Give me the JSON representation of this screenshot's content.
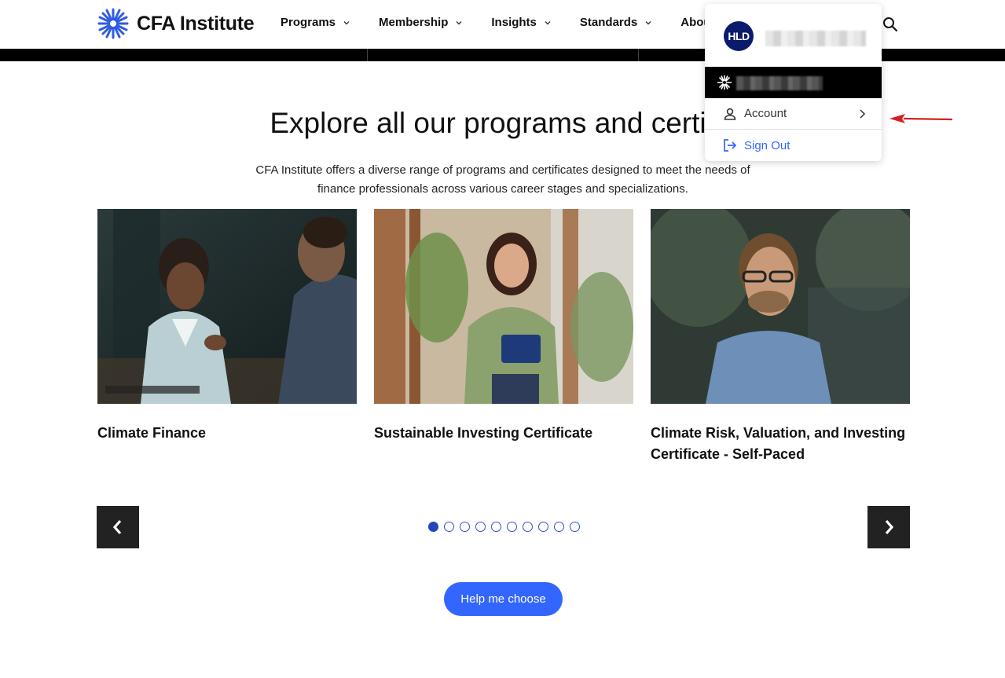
{
  "header": {
    "logo_text": "CFA Institute",
    "nav": [
      {
        "label": "Programs"
      },
      {
        "label": "Membership"
      },
      {
        "label": "Insights"
      },
      {
        "label": "Standards"
      },
      {
        "label": "About"
      }
    ]
  },
  "main": {
    "title": "Explore all our programs and certific",
    "description": "CFA Institute offers a diverse range of programs and certificates designed to meet the needs of finance professionals across various career stages and specializations.",
    "cards": [
      {
        "title": "Climate Finance"
      },
      {
        "title": "Sustainable Investing Certificate"
      },
      {
        "title": "Climate Risk, Valuation, and Investing Certificate - Self-Paced"
      }
    ],
    "carousel": {
      "total_pages": 10,
      "active_page": 1
    },
    "help_button": "Help me choose"
  },
  "dropdown": {
    "avatar_initials": "HLD",
    "account_label": "Account",
    "signout_label": "Sign Out"
  },
  "colors": {
    "brand_blue": "#3366ff",
    "avatar_navy": "#0b1b6b",
    "annotation_red": "#d42020"
  }
}
